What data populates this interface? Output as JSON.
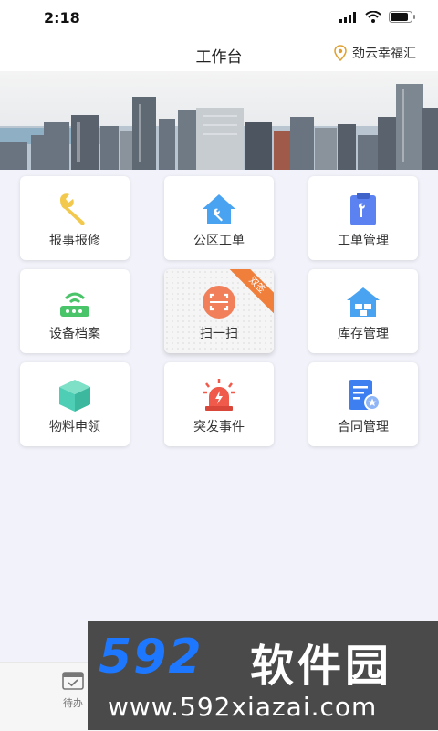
{
  "status_bar": {
    "time": "2:18"
  },
  "header": {
    "title": "工作台",
    "location": "劲云幸福汇"
  },
  "grid": [
    {
      "label": "报事报修",
      "icon": "wrench-icon",
      "color": "#f2c94c"
    },
    {
      "label": "公区工单",
      "icon": "house-wrench-icon",
      "color": "#4aa3f0"
    },
    {
      "label": "工单管理",
      "icon": "clipboard-icon",
      "color": "#5b82f0"
    },
    {
      "label": "设备档案",
      "icon": "router-icon",
      "color": "#49c468"
    },
    {
      "label": "扫一扫",
      "icon": "scan-icon",
      "color": "#f07f5a",
      "badge": "双签"
    },
    {
      "label": "库存管理",
      "icon": "warehouse-icon",
      "color": "#4aa3f0"
    },
    {
      "label": "物料申领",
      "icon": "box-icon",
      "color": "#4ecfb5"
    },
    {
      "label": "突发事件",
      "icon": "alarm-icon",
      "color": "#f05a4a"
    },
    {
      "label": "合同管理",
      "icon": "contract-icon",
      "color": "#3d7ef0"
    }
  ],
  "tabbar": {
    "todo_label": "待办"
  },
  "watermark": {
    "brand": "592",
    "name": "软件园",
    "url": "www.592xiazai.com"
  }
}
